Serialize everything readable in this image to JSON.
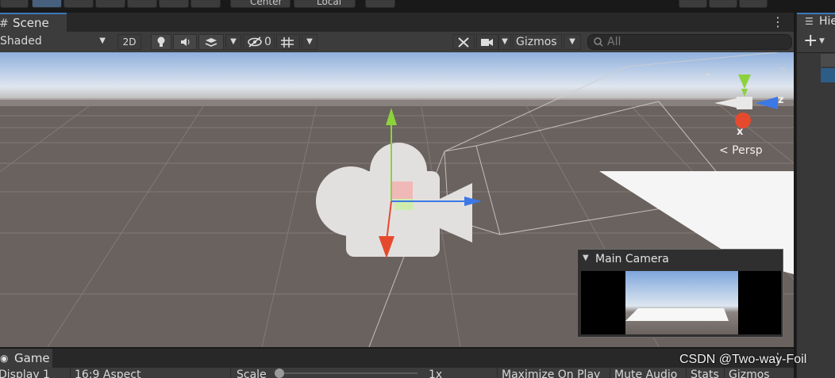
{
  "top_toolbar": {
    "center_label": "Center",
    "local_label": "Local"
  },
  "scene": {
    "tab_label": "Scene",
    "shading_mode": "Shaded",
    "btn_2d": "2D",
    "hidden_count": "0",
    "gizmos_label": "Gizmos",
    "search_placeholder": "All"
  },
  "hierarchy": {
    "tab_label_partial": "Hie",
    "add_symbol": "+"
  },
  "orientation_gizmo": {
    "axis_z": "z",
    "axis_x": "x",
    "projection_label": "< Persp"
  },
  "camera_preview": {
    "title": "Main Camera"
  },
  "game": {
    "tab_label": "Game",
    "display_label": "Display 1",
    "aspect_label": "16:9 Aspect",
    "scale_label": "Scale",
    "scale_value": "1x",
    "maximize_label": "Maximize On Play",
    "mute_label": "Mute Audio",
    "stats_label": "Stats",
    "gizmos_label": "Gizmos"
  },
  "watermark": "CSDN @Two-way-Foil",
  "colors": {
    "sky_top": "#8fb0dd",
    "horizon": "#e9eef5",
    "ground": "#6a625e",
    "accent_blue": "#3a79bb",
    "axis_y_green": "#8cd23c",
    "axis_z_blue": "#3c78e6",
    "axis_x_red": "#e64a2e"
  }
}
